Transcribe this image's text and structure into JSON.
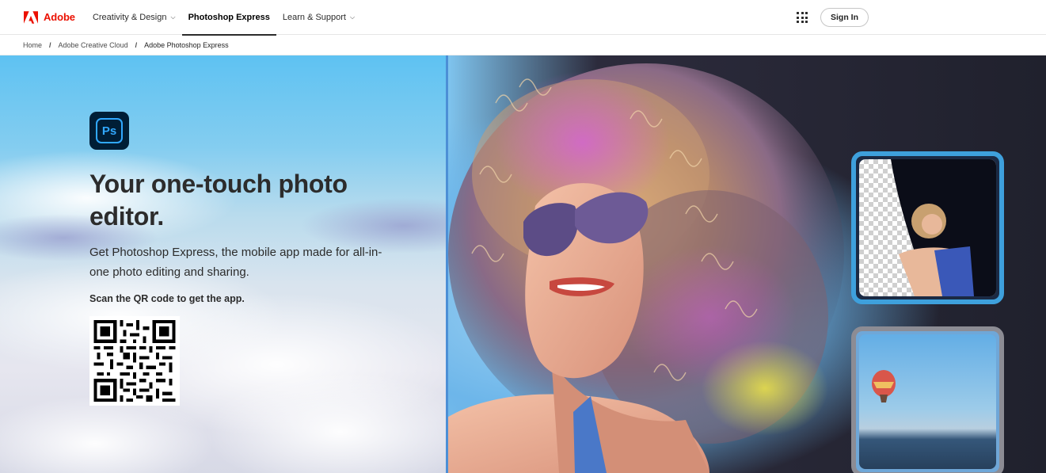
{
  "nav": {
    "brand": "Adobe",
    "items": [
      {
        "label": "Creativity & Design"
      },
      {
        "label": "Photoshop Express"
      },
      {
        "label": "Learn & Support"
      }
    ],
    "apps_icon": "apps-grid-icon",
    "signin_label": "Sign In"
  },
  "breadcrumb": {
    "items": [
      "Home",
      "Adobe Creative Cloud",
      "Adobe Photoshop Express"
    ],
    "separator": "/"
  },
  "hero": {
    "app_icon_text": "Ps",
    "title": "Your one-touch photo editor.",
    "description": "Get Photoshop Express, the mobile app made for all-in-one photo editing and sharing.",
    "cta": "Scan the QR code to get the app."
  },
  "colors": {
    "adobe_red": "#eb1000",
    "ps_blue": "#31a8ff",
    "ps_dark": "#001e36",
    "divider_blue": "#4c8fd6",
    "text_dark": "#2c2c2c"
  }
}
